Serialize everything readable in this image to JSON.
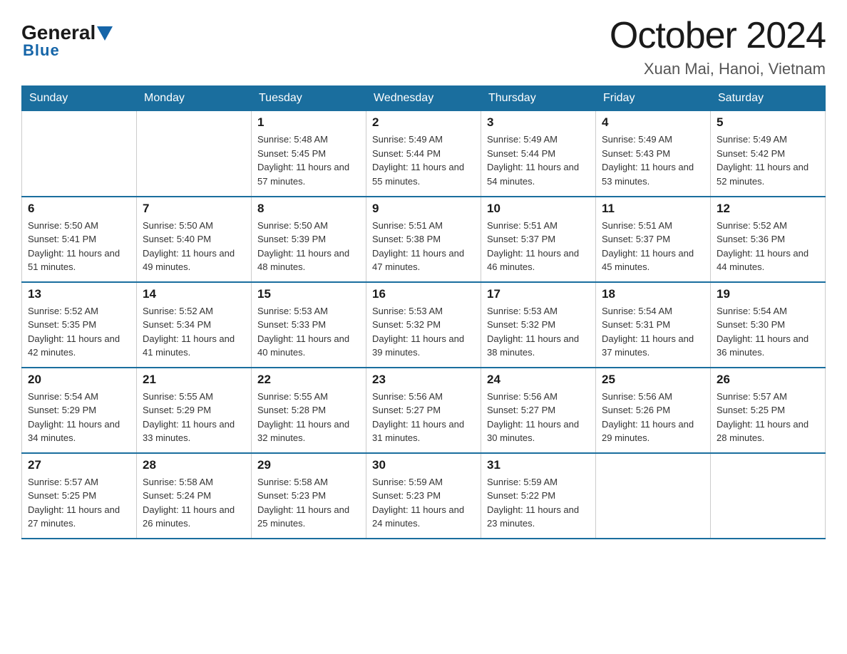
{
  "header": {
    "logo_general": "General",
    "logo_blue": "Blue",
    "month_title": "October 2024",
    "location": "Xuan Mai, Hanoi, Vietnam"
  },
  "days_of_week": [
    "Sunday",
    "Monday",
    "Tuesday",
    "Wednesday",
    "Thursday",
    "Friday",
    "Saturday"
  ],
  "weeks": [
    [
      {
        "day": "",
        "sunrise": "",
        "sunset": "",
        "daylight": ""
      },
      {
        "day": "",
        "sunrise": "",
        "sunset": "",
        "daylight": ""
      },
      {
        "day": "1",
        "sunrise": "Sunrise: 5:48 AM",
        "sunset": "Sunset: 5:45 PM",
        "daylight": "Daylight: 11 hours and 57 minutes."
      },
      {
        "day": "2",
        "sunrise": "Sunrise: 5:49 AM",
        "sunset": "Sunset: 5:44 PM",
        "daylight": "Daylight: 11 hours and 55 minutes."
      },
      {
        "day": "3",
        "sunrise": "Sunrise: 5:49 AM",
        "sunset": "Sunset: 5:44 PM",
        "daylight": "Daylight: 11 hours and 54 minutes."
      },
      {
        "day": "4",
        "sunrise": "Sunrise: 5:49 AM",
        "sunset": "Sunset: 5:43 PM",
        "daylight": "Daylight: 11 hours and 53 minutes."
      },
      {
        "day": "5",
        "sunrise": "Sunrise: 5:49 AM",
        "sunset": "Sunset: 5:42 PM",
        "daylight": "Daylight: 11 hours and 52 minutes."
      }
    ],
    [
      {
        "day": "6",
        "sunrise": "Sunrise: 5:50 AM",
        "sunset": "Sunset: 5:41 PM",
        "daylight": "Daylight: 11 hours and 51 minutes."
      },
      {
        "day": "7",
        "sunrise": "Sunrise: 5:50 AM",
        "sunset": "Sunset: 5:40 PM",
        "daylight": "Daylight: 11 hours and 49 minutes."
      },
      {
        "day": "8",
        "sunrise": "Sunrise: 5:50 AM",
        "sunset": "Sunset: 5:39 PM",
        "daylight": "Daylight: 11 hours and 48 minutes."
      },
      {
        "day": "9",
        "sunrise": "Sunrise: 5:51 AM",
        "sunset": "Sunset: 5:38 PM",
        "daylight": "Daylight: 11 hours and 47 minutes."
      },
      {
        "day": "10",
        "sunrise": "Sunrise: 5:51 AM",
        "sunset": "Sunset: 5:37 PM",
        "daylight": "Daylight: 11 hours and 46 minutes."
      },
      {
        "day": "11",
        "sunrise": "Sunrise: 5:51 AM",
        "sunset": "Sunset: 5:37 PM",
        "daylight": "Daylight: 11 hours and 45 minutes."
      },
      {
        "day": "12",
        "sunrise": "Sunrise: 5:52 AM",
        "sunset": "Sunset: 5:36 PM",
        "daylight": "Daylight: 11 hours and 44 minutes."
      }
    ],
    [
      {
        "day": "13",
        "sunrise": "Sunrise: 5:52 AM",
        "sunset": "Sunset: 5:35 PM",
        "daylight": "Daylight: 11 hours and 42 minutes."
      },
      {
        "day": "14",
        "sunrise": "Sunrise: 5:52 AM",
        "sunset": "Sunset: 5:34 PM",
        "daylight": "Daylight: 11 hours and 41 minutes."
      },
      {
        "day": "15",
        "sunrise": "Sunrise: 5:53 AM",
        "sunset": "Sunset: 5:33 PM",
        "daylight": "Daylight: 11 hours and 40 minutes."
      },
      {
        "day": "16",
        "sunrise": "Sunrise: 5:53 AM",
        "sunset": "Sunset: 5:32 PM",
        "daylight": "Daylight: 11 hours and 39 minutes."
      },
      {
        "day": "17",
        "sunrise": "Sunrise: 5:53 AM",
        "sunset": "Sunset: 5:32 PM",
        "daylight": "Daylight: 11 hours and 38 minutes."
      },
      {
        "day": "18",
        "sunrise": "Sunrise: 5:54 AM",
        "sunset": "Sunset: 5:31 PM",
        "daylight": "Daylight: 11 hours and 37 minutes."
      },
      {
        "day": "19",
        "sunrise": "Sunrise: 5:54 AM",
        "sunset": "Sunset: 5:30 PM",
        "daylight": "Daylight: 11 hours and 36 minutes."
      }
    ],
    [
      {
        "day": "20",
        "sunrise": "Sunrise: 5:54 AM",
        "sunset": "Sunset: 5:29 PM",
        "daylight": "Daylight: 11 hours and 34 minutes."
      },
      {
        "day": "21",
        "sunrise": "Sunrise: 5:55 AM",
        "sunset": "Sunset: 5:29 PM",
        "daylight": "Daylight: 11 hours and 33 minutes."
      },
      {
        "day": "22",
        "sunrise": "Sunrise: 5:55 AM",
        "sunset": "Sunset: 5:28 PM",
        "daylight": "Daylight: 11 hours and 32 minutes."
      },
      {
        "day": "23",
        "sunrise": "Sunrise: 5:56 AM",
        "sunset": "Sunset: 5:27 PM",
        "daylight": "Daylight: 11 hours and 31 minutes."
      },
      {
        "day": "24",
        "sunrise": "Sunrise: 5:56 AM",
        "sunset": "Sunset: 5:27 PM",
        "daylight": "Daylight: 11 hours and 30 minutes."
      },
      {
        "day": "25",
        "sunrise": "Sunrise: 5:56 AM",
        "sunset": "Sunset: 5:26 PM",
        "daylight": "Daylight: 11 hours and 29 minutes."
      },
      {
        "day": "26",
        "sunrise": "Sunrise: 5:57 AM",
        "sunset": "Sunset: 5:25 PM",
        "daylight": "Daylight: 11 hours and 28 minutes."
      }
    ],
    [
      {
        "day": "27",
        "sunrise": "Sunrise: 5:57 AM",
        "sunset": "Sunset: 5:25 PM",
        "daylight": "Daylight: 11 hours and 27 minutes."
      },
      {
        "day": "28",
        "sunrise": "Sunrise: 5:58 AM",
        "sunset": "Sunset: 5:24 PM",
        "daylight": "Daylight: 11 hours and 26 minutes."
      },
      {
        "day": "29",
        "sunrise": "Sunrise: 5:58 AM",
        "sunset": "Sunset: 5:23 PM",
        "daylight": "Daylight: 11 hours and 25 minutes."
      },
      {
        "day": "30",
        "sunrise": "Sunrise: 5:59 AM",
        "sunset": "Sunset: 5:23 PM",
        "daylight": "Daylight: 11 hours and 24 minutes."
      },
      {
        "day": "31",
        "sunrise": "Sunrise: 5:59 AM",
        "sunset": "Sunset: 5:22 PM",
        "daylight": "Daylight: 11 hours and 23 minutes."
      },
      {
        "day": "",
        "sunrise": "",
        "sunset": "",
        "daylight": ""
      },
      {
        "day": "",
        "sunrise": "",
        "sunset": "",
        "daylight": ""
      }
    ]
  ]
}
